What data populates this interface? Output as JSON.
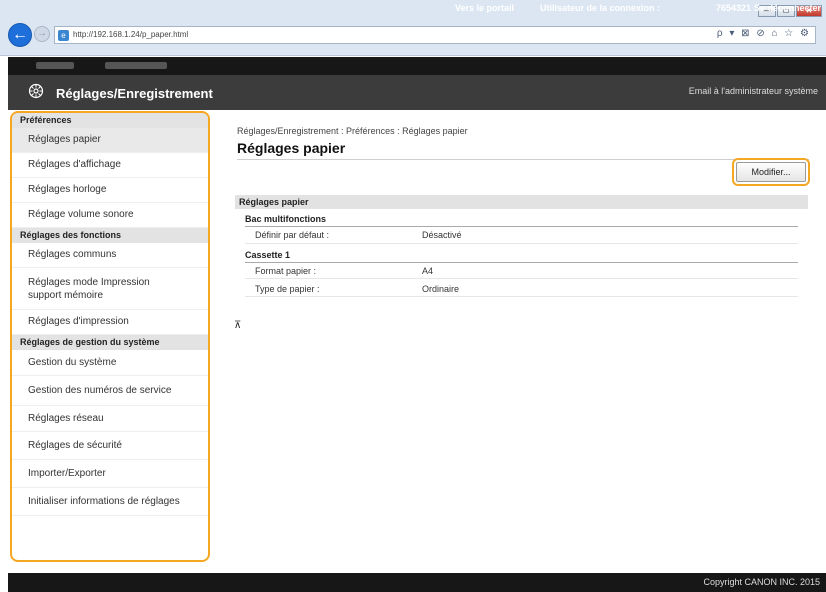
{
  "browser": {
    "url": "http://192.168.1.24/p_paper.html",
    "window_controls": [
      "—",
      "▭",
      "✕"
    ],
    "address_tools": "ρ ▾ ⊠ ⊘   ⌂ ☆ ⚙"
  },
  "topbar": {
    "portal_link": "Vers le portail",
    "user_label": "Utilisateur de la connexion :",
    "user_value": "7654321",
    "logout_link": "Se déconnecter"
  },
  "header": {
    "title": "Réglages/Enregistrement",
    "admin_email": "Email à l'administrateur système"
  },
  "sidebar": {
    "sections": [
      {
        "title": "Préférences",
        "items": [
          {
            "label": "Réglages papier",
            "active": true
          },
          {
            "label": "Réglages d'affichage"
          },
          {
            "label": "Réglages horloge"
          },
          {
            "label": "Réglage volume sonore"
          }
        ]
      },
      {
        "title": "Réglages des fonctions",
        "items": [
          {
            "label": "Réglages communs"
          },
          {
            "label": "Réglages mode Impression support mémoire"
          },
          {
            "label": "Réglages d'impression"
          }
        ]
      },
      {
        "title": "Réglages de gestion du système",
        "items": [
          {
            "label": "Gestion du système"
          },
          {
            "label": "Gestion des numéros de service"
          },
          {
            "label": "Réglages réseau"
          },
          {
            "label": "Réglages de sécurité"
          },
          {
            "label": "Importer/Exporter"
          },
          {
            "label": "Initialiser informations de réglages"
          }
        ]
      }
    ]
  },
  "main": {
    "breadcrumb": "Réglages/Enregistrement : Préférences : Réglages papier",
    "page_title": "Réglages papier",
    "modify_button": "Modifier...",
    "section_head": "Réglages papier",
    "groups": [
      {
        "title": "Bac multifonctions",
        "rows": [
          {
            "label": "Définir par défaut :",
            "value": "Désactivé"
          }
        ]
      },
      {
        "title": "Cassette 1",
        "rows": [
          {
            "label": "Format papier :",
            "value": "A4"
          },
          {
            "label": "Type de papier :",
            "value": "Ordinaire"
          }
        ]
      }
    ],
    "top_arrow": "⊼"
  },
  "footer": {
    "copyright": "Copyright CANON INC. 2015"
  }
}
